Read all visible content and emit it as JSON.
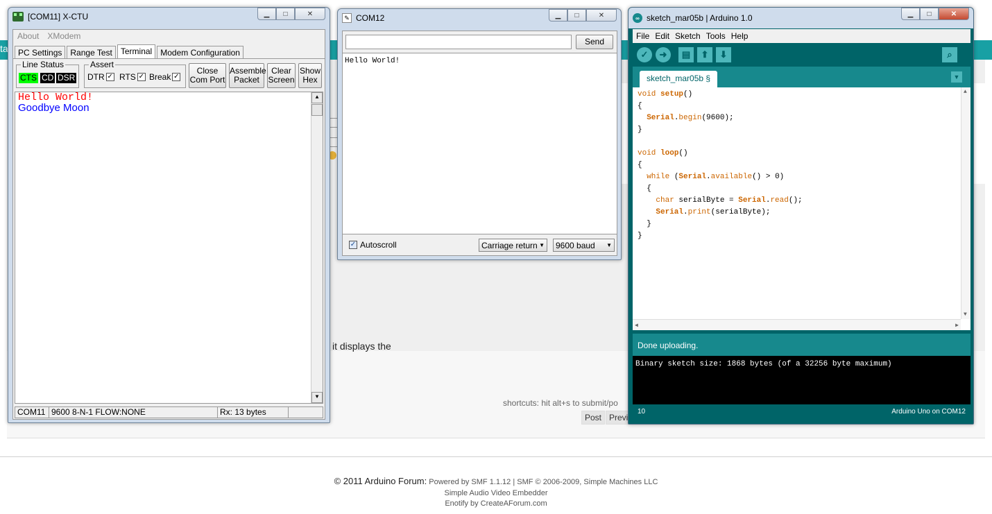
{
  "background": {
    "teal_stub": "ta",
    "displays_text": "it displays the",
    "shortcuts_text": "shortcuts: hit alt+s to submit/po",
    "post_button": "Post",
    "preview_button": "Previ",
    "footer": {
      "copyright": "© 2011 Arduino Forum:",
      "powered_by": "Powered by SMF 1.1.12 | SMF © 2006-2009, Simple Machines LLC",
      "line2": "Simple Audio Video Embedder",
      "line3": "Enotify by CreateAForum.com"
    }
  },
  "xctu": {
    "title": "[COM11] X-CTU",
    "menu": [
      "About",
      "XModem"
    ],
    "tabs": [
      "PC Settings",
      "Range Test",
      "Terminal",
      "Modem Configuration"
    ],
    "active_tab": "Terminal",
    "line_status": {
      "label": "Line Status",
      "cts": "CTS",
      "cd": "CD",
      "dsr": "DSR"
    },
    "assert": {
      "label": "Assert",
      "dtr": "DTR",
      "rts": "RTS",
      "break": "Break"
    },
    "buttons": {
      "close_com_1": "Close",
      "close_com_2": "Com Port",
      "assemble_1": "Assemble",
      "assemble_2": "Packet",
      "clear_1": "Clear",
      "clear_2": "Screen",
      "show_1": "Show",
      "show_2": "Hex"
    },
    "terminal_lines": [
      {
        "text": "Hello World!",
        "color": "#ff0000"
      },
      {
        "text": "Goodbye Moon",
        "color": "#0000ff"
      }
    ],
    "status": {
      "port": "COM11",
      "settings": "9600 8-N-1  FLOW:NONE",
      "rx": "Rx: 13 bytes"
    },
    "colors": {
      "line_on": "#00ff00",
      "line_off": "#000000"
    }
  },
  "com12": {
    "title": "COM12",
    "input_value": "",
    "send_label": "Send",
    "output": "Hello World!",
    "autoscroll_label": "Autoscroll",
    "line_ending": "Carriage return",
    "baud": "9600 baud"
  },
  "arduino": {
    "title": "sketch_mar05b | Arduino 1.0",
    "menu": [
      "File",
      "Edit",
      "Sketch",
      "Tools",
      "Help"
    ],
    "tab_label": "sketch_mar05b §",
    "code": [
      "void setup()",
      "{",
      "  Serial.begin(9600);",
      "}",
      "",
      "void loop()",
      "{",
      "  while (Serial.available() > 0)",
      "  {",
      "    char serialByte = Serial.read();",
      "    Serial.print(serialByte);",
      "  }",
      "}"
    ],
    "status": "Done uploading.",
    "console": "Binary sketch size: 1868 bytes (of a 32256 byte maximum)",
    "line_number": "10",
    "board": "Arduino Uno on COM12",
    "colors": {
      "teal_dark": "#006468",
      "teal_mid": "#17898d",
      "teal_light": "#4db7bb",
      "keyword": "#cc6600"
    }
  }
}
